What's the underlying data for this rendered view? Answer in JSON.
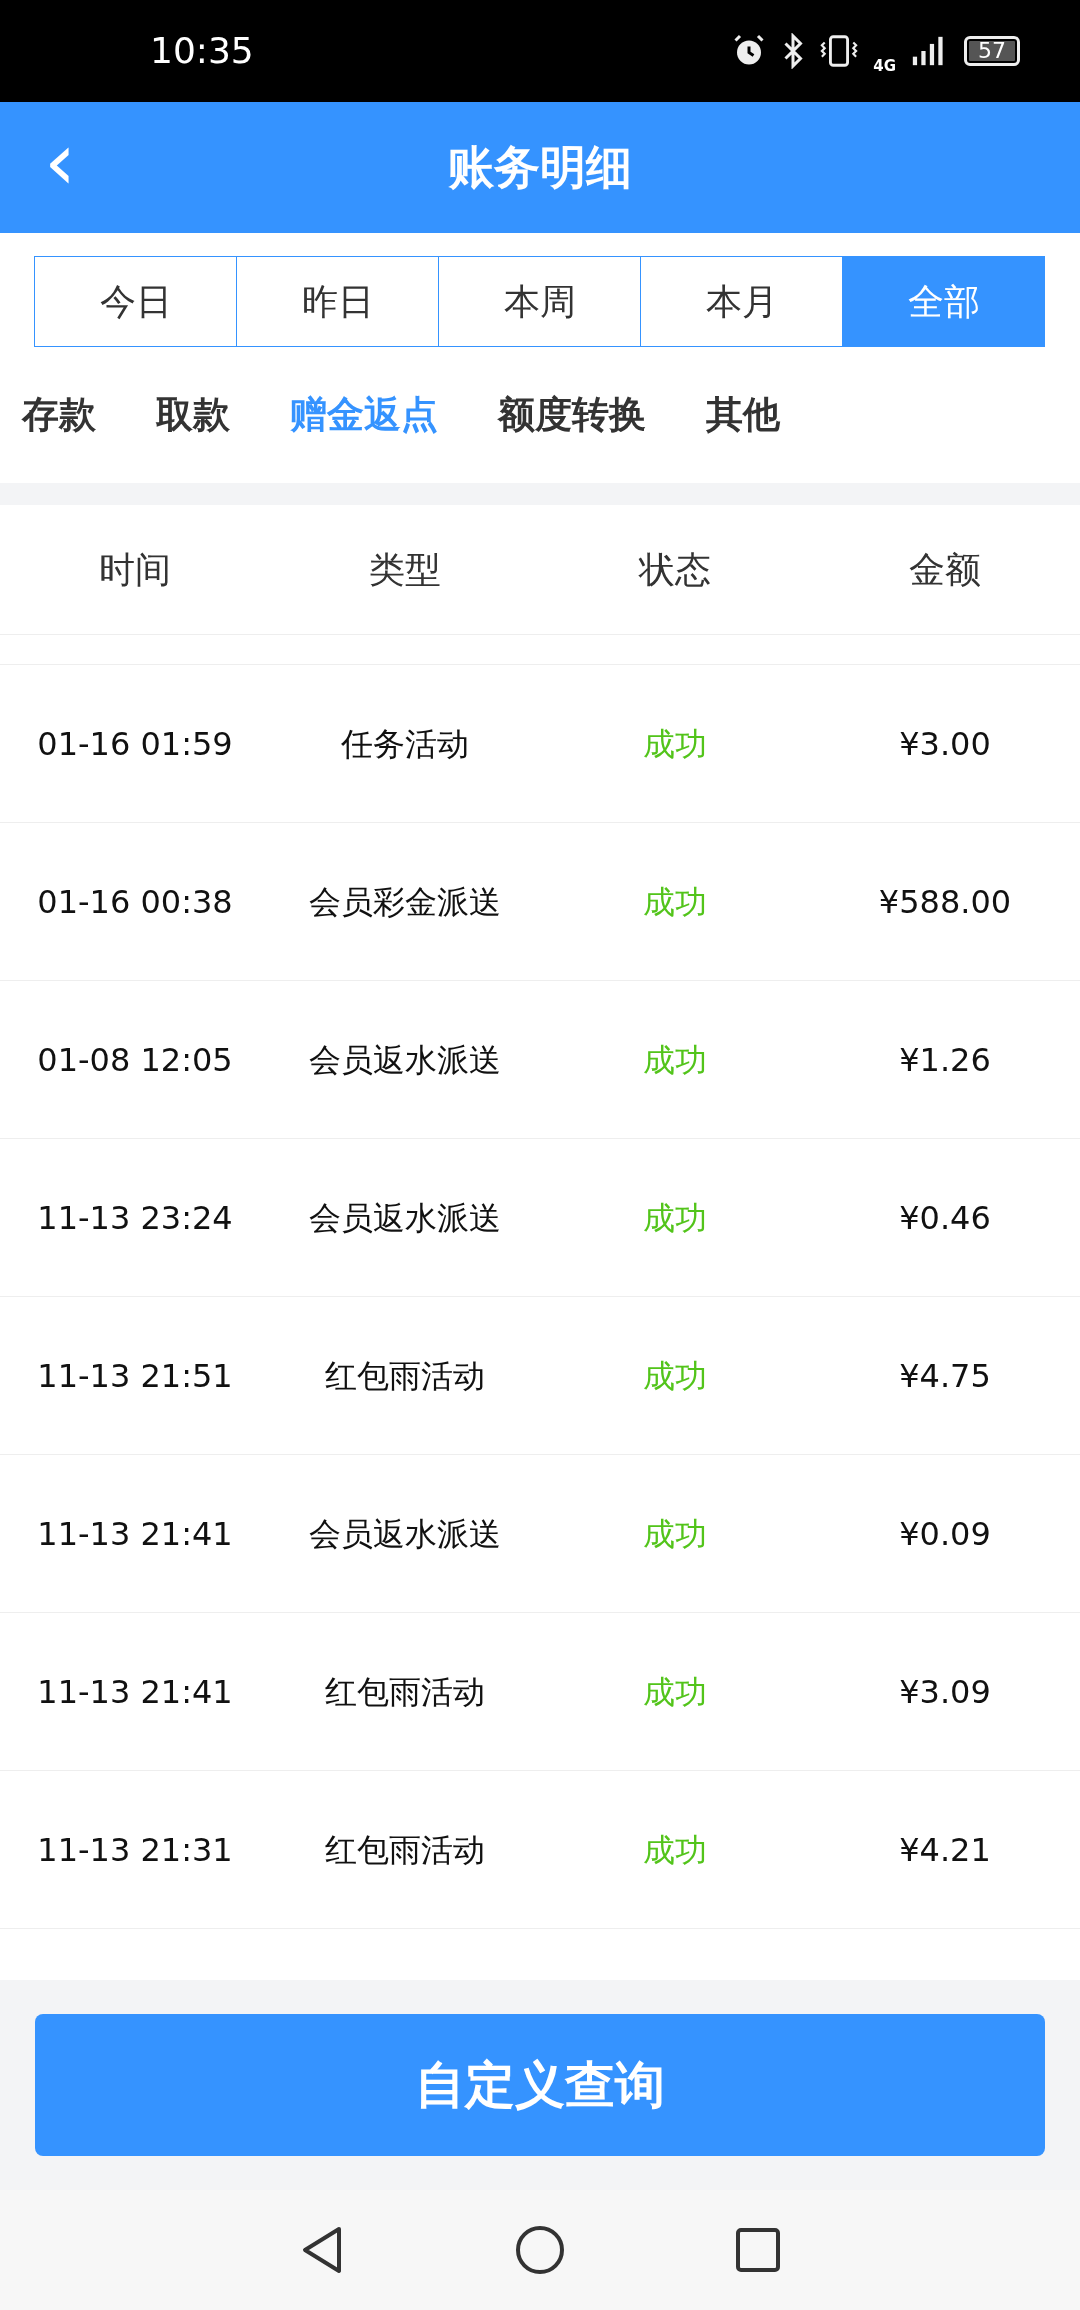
{
  "status_bar": {
    "time": "10:35",
    "network": "4G",
    "battery": "57"
  },
  "header": {
    "back": "‹",
    "title": "账务明细"
  },
  "period_tabs": [
    {
      "label": "今日",
      "selected": false
    },
    {
      "label": "昨日",
      "selected": false
    },
    {
      "label": "本周",
      "selected": false
    },
    {
      "label": "本月",
      "selected": false
    },
    {
      "label": "全部",
      "selected": true
    }
  ],
  "category_tabs": [
    {
      "label": "存款",
      "selected": false
    },
    {
      "label": "取款",
      "selected": false
    },
    {
      "label": "赠金返点",
      "selected": true
    },
    {
      "label": "额度转换",
      "selected": false
    },
    {
      "label": "其他",
      "selected": false
    }
  ],
  "table": {
    "columns": [
      "时间",
      "类型",
      "状态",
      "金额"
    ],
    "rows": [
      {
        "time": "01-16 01:59",
        "type": "任务活动",
        "status": "成功",
        "amount": "¥3.00"
      },
      {
        "time": "01-16 00:38",
        "type": "会员彩金派送",
        "status": "成功",
        "amount": "¥588.00"
      },
      {
        "time": "01-08 12:05",
        "type": "会员返水派送",
        "status": "成功",
        "amount": "¥1.26"
      },
      {
        "time": "11-13 23:24",
        "type": "会员返水派送",
        "status": "成功",
        "amount": "¥0.46"
      },
      {
        "time": "11-13 21:51",
        "type": "红包雨活动",
        "status": "成功",
        "amount": "¥4.75"
      },
      {
        "time": "11-13 21:41",
        "type": "会员返水派送",
        "status": "成功",
        "amount": "¥0.09"
      },
      {
        "time": "11-13 21:41",
        "type": "红包雨活动",
        "status": "成功",
        "amount": "¥3.09"
      },
      {
        "time": "11-13 21:31",
        "type": "红包雨活动",
        "status": "成功",
        "amount": "¥4.21"
      }
    ]
  },
  "query_button": "自定义查询"
}
